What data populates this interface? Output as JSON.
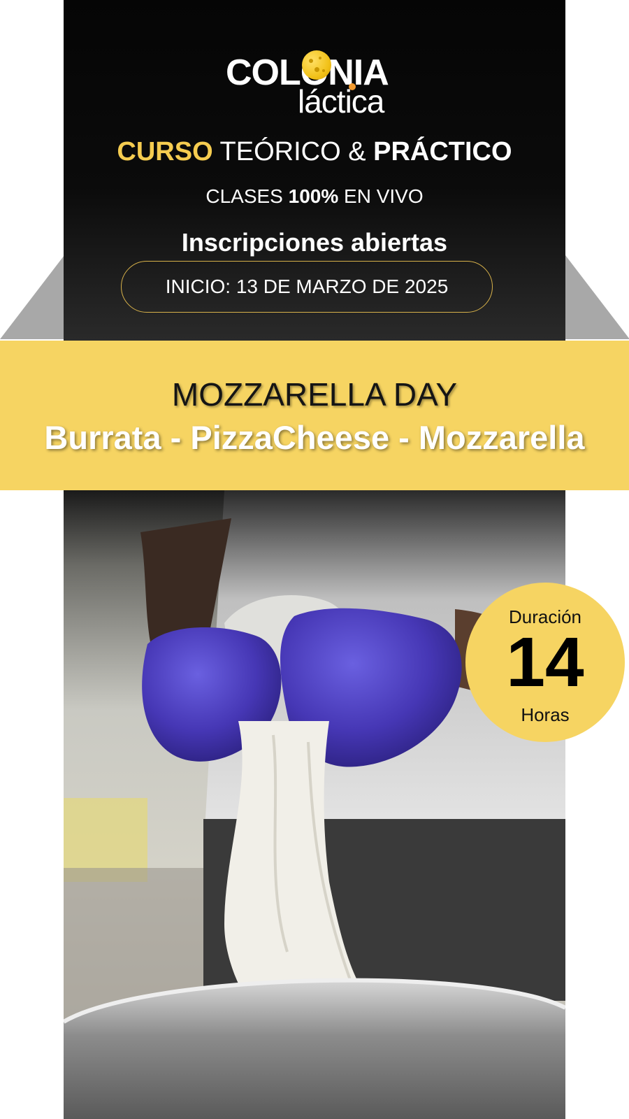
{
  "logo": {
    "word1": "COLONIA",
    "word2": "láctica"
  },
  "course": {
    "part1": "CURSO",
    "part2": " TEÓRICO & ",
    "part3": "PRÁCTICO"
  },
  "classes": {
    "part1": "CLASES ",
    "part2": "100%",
    "part3": " EN VIVO"
  },
  "enrollment": "Inscripciones abiertas",
  "start_date": "INICIO: 13 DE MARZO DE 2025",
  "banner": {
    "title": "MOZZARELLA DAY",
    "subtitle": "Burrata - PizzaCheese - Mozzarella"
  },
  "duration": {
    "label": "Duración",
    "value": "14",
    "unit": "Horas"
  },
  "colors": {
    "accent_yellow": "#f6d462",
    "header_black": "#0b0b0b",
    "glove_purple": "#4a3fb8"
  }
}
